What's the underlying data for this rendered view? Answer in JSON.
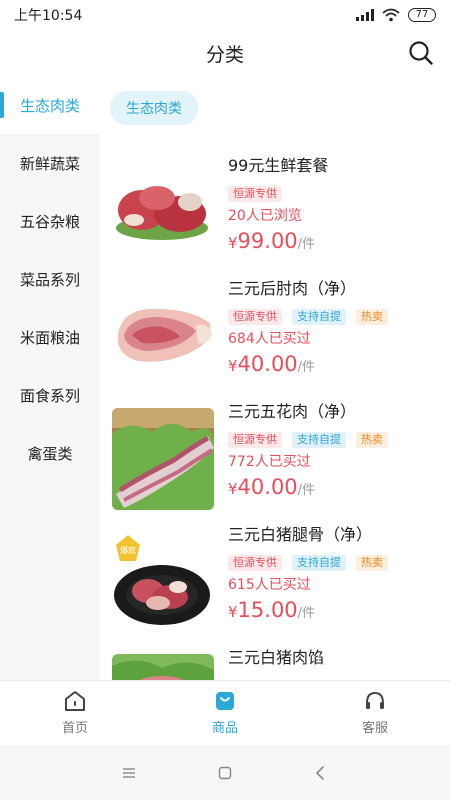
{
  "status_bar": {
    "time": "上午10:54",
    "battery": "77"
  },
  "header": {
    "title": "分类"
  },
  "sidebar": {
    "items": [
      {
        "label": "生态肉类",
        "active": true
      },
      {
        "label": "新鲜蔬菜",
        "active": false
      },
      {
        "label": "五谷杂粮",
        "active": false
      },
      {
        "label": "菜品系列",
        "active": false
      },
      {
        "label": "米面粮油",
        "active": false
      },
      {
        "label": "面食系列",
        "active": false
      },
      {
        "label": "禽蛋类",
        "active": false
      }
    ]
  },
  "category_chip": "生态肉类",
  "products": [
    {
      "name": "99元生鲜套餐",
      "tags": [
        "恒源专供"
      ],
      "stat": "20人已浏览",
      "currency": "¥",
      "price": "99.00",
      "unit": "/件"
    },
    {
      "name": "三元后肘肉（净）",
      "tags": [
        "恒源专供",
        "支持自提",
        "热卖"
      ],
      "stat": "684人已买过",
      "currency": "¥",
      "price": "40.00",
      "unit": "/件"
    },
    {
      "name": "三元五花肉（净）",
      "tags": [
        "恒源专供",
        "支持自提",
        "热卖"
      ],
      "stat": "772人已买过",
      "currency": "¥",
      "price": "40.00",
      "unit": "/件"
    },
    {
      "name": "三元白猪腿骨（净）",
      "tags": [
        "恒源专供",
        "支持自提",
        "热卖"
      ],
      "stat": "615人已买过",
      "currency": "¥",
      "price": "15.00",
      "unit": "/件",
      "badge": "爆款"
    },
    {
      "name": "三元白猪肉馅",
      "tags": [],
      "stat": "",
      "currency": "",
      "price": "",
      "unit": ""
    }
  ],
  "tabbar": {
    "tabs": [
      {
        "label": "首页",
        "icon": "home-icon"
      },
      {
        "label": "商品",
        "icon": "shopping-bag-icon",
        "active": true
      },
      {
        "label": "客服",
        "icon": "headset-icon"
      }
    ]
  },
  "colors": {
    "accent": "#2aa8d8",
    "price": "#e84e5a",
    "hot": "#f08a24"
  }
}
